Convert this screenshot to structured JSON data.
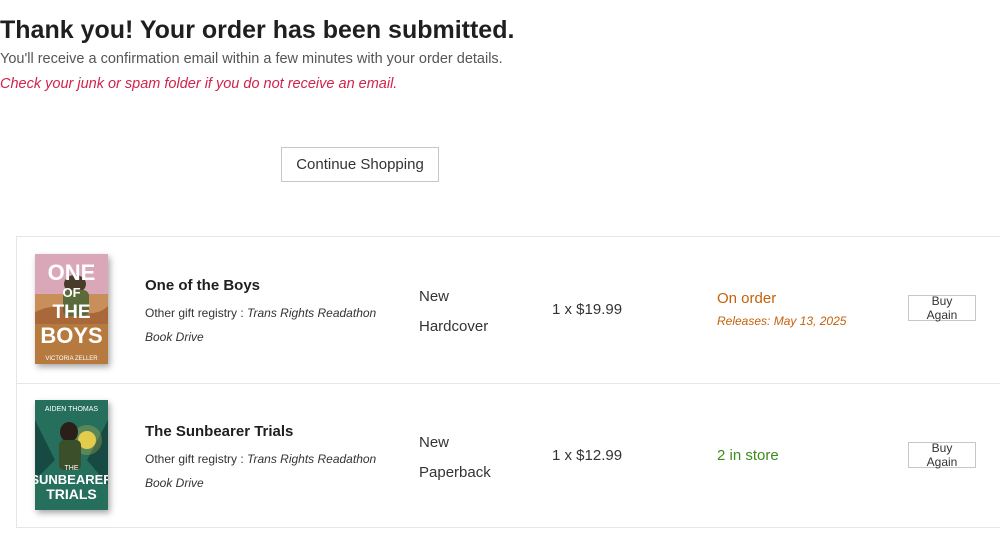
{
  "confirmation": {
    "title": "Thank you! Your order has been submitted.",
    "subtitle": "You'll receive a confirmation email within a few minutes with your order details.",
    "spam_note": "Check your junk or spam folder if you do not receive an email.",
    "continue_label": "Continue Shopping"
  },
  "items": [
    {
      "title": "One of the Boys",
      "registry_prefix": "Other gift registry : ",
      "registry_name": "Trans Rights Readathon Book Drive",
      "condition": "New",
      "format": "Hardcover",
      "price": "1 x $19.99",
      "status": "On order",
      "release": "Releases: May 13, 2025",
      "buy_again_label": "Buy Again",
      "cover": {
        "line1": "ONE",
        "line2": "OF",
        "line3": "THE",
        "line4": "BOYS",
        "author": "VICTORIA ZELLER"
      }
    },
    {
      "title": "The Sunbearer Trials",
      "registry_prefix": "Other gift registry : ",
      "registry_name": "Trans Rights Readathon Book Drive",
      "condition": "New",
      "format": "Paperback",
      "price": "1 x $12.99",
      "status": "2 in store",
      "buy_again_label": "Buy Again",
      "cover": {
        "author": "AIDEN THOMAS",
        "line1": "THE",
        "line2": "SUNBEARER",
        "line3": "TRIALS"
      }
    }
  ],
  "colors": {
    "spam_note": "#d0234b",
    "on_order": "#c4610a",
    "in_store": "#3d8b1f"
  }
}
